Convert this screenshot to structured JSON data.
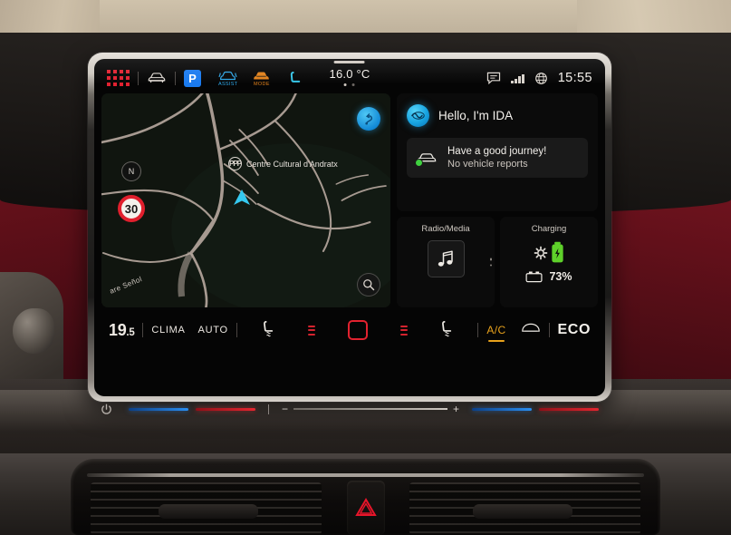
{
  "statusbar": {
    "apps_icon": "app-grid-icon",
    "car_icon": "car-front-icon",
    "parking_label": "P",
    "assist_label": "ASSIST",
    "mode_label": "MODE",
    "seat_icon": "seat-icon",
    "outside_temp": "16.0 °C",
    "message_icon": "message-bubble-icon",
    "signal_icon": "signal-bars-icon",
    "globe_icon": "globe-icon",
    "clock": "15:55"
  },
  "map": {
    "poi_label": "Centre Cultural d'Andratx",
    "poi_icon": "parking-poi-icon",
    "street_label": "are Señol",
    "speed_limit": "30",
    "compass_label": "N",
    "route_icon": "route-icon",
    "search_icon": "search-icon",
    "position_icon": "vehicle-position-arrow",
    "road_color": "#a89a91",
    "bg_color": "#0e120f"
  },
  "ida": {
    "title": "Hello, I'm IDA",
    "orb_icon": "ida-voice-orb-icon",
    "note_icon": "car-status-icon",
    "note_line1": "Have a good journey!",
    "note_line2": "No vehicle reports",
    "status_color": "#3fd13f"
  },
  "tiles": {
    "media": {
      "title": "Radio/Media",
      "icon": "music-note-icon"
    },
    "charging": {
      "title": "Charging",
      "battery_icon": "battery-charging-icon",
      "settings_icon": "gear-icon",
      "level_icon": "battery-level-icon",
      "level": "73%",
      "accent": "#5ed12a"
    }
  },
  "climate": {
    "driver_temp_int": "19",
    "driver_temp_dec": ".5",
    "clima_label": "CLIMA",
    "auto_label": "AUTO",
    "seat_heat_left_icon": "seat-heating-icon",
    "fan_left_icon": "fan-level-icon",
    "home_icon": "home-square-icon",
    "fan_right_icon": "fan-level-icon",
    "seat_heat_right_icon": "seat-heating-icon",
    "ac_label": "A/C",
    "ac_color": "#e8a21c",
    "defrost_icon": "windscreen-defrost-icon",
    "eco_label": "ECO"
  },
  "hardware": {
    "power_icon": "power-icon",
    "temp_left_cold": "cold-slider",
    "temp_left_warm": "warm-slider",
    "volume_minus": "−",
    "volume_icon": "volume-icon",
    "volume_plus": "+",
    "temp_right_cold": "cold-slider",
    "temp_right_warm": "warm-slider"
  },
  "cabin": {
    "hazard_icon": "hazard-warning-icon",
    "hazard_color": "#e8152a",
    "vent_left": "air-vent-left",
    "vent_right": "air-vent-right",
    "stitch_color": "#c0212e"
  }
}
